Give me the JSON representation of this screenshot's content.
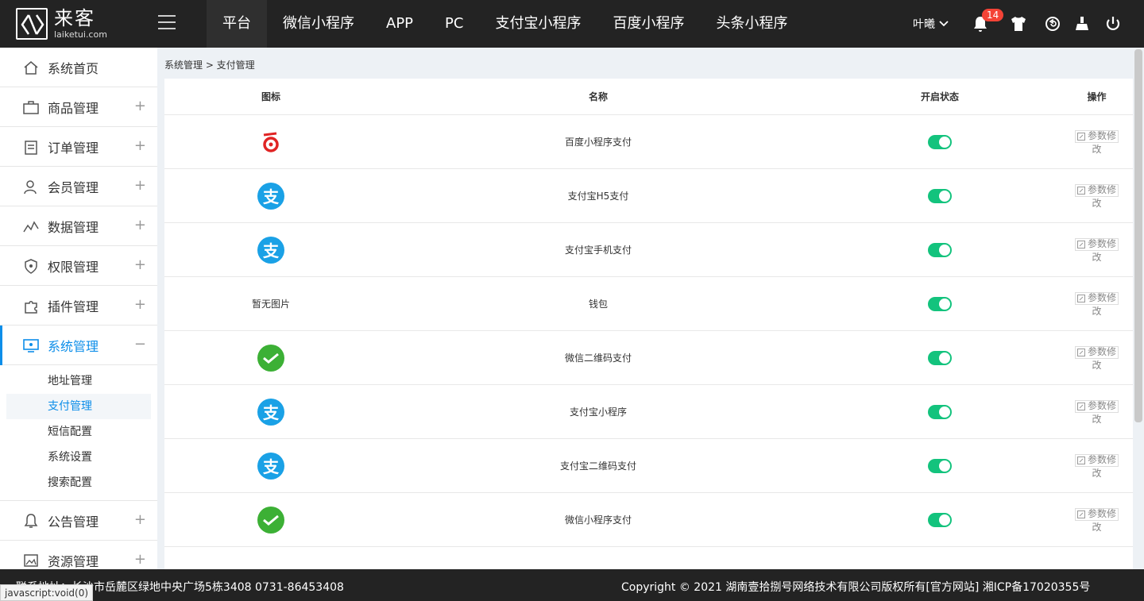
{
  "header": {
    "logo_cn": "来客",
    "logo_en": "laiketui.com",
    "nav": [
      "平台",
      "微信小程序",
      "APP",
      "PC",
      "支付宝小程序",
      "百度小程序",
      "头条小程序"
    ],
    "user": "叶曦",
    "notify_count": "14",
    "icons": [
      "bell-icon",
      "shirt-icon",
      "refresh-icon",
      "broom-icon",
      "power-icon"
    ]
  },
  "sidebar": {
    "items": [
      {
        "label": "系统首页",
        "icon": "home-icon",
        "expandable": false
      },
      {
        "label": "商品管理",
        "icon": "briefcase-icon",
        "expandable": true
      },
      {
        "label": "订单管理",
        "icon": "clipboard-icon",
        "expandable": true
      },
      {
        "label": "会员管理",
        "icon": "users-icon",
        "expandable": true
      },
      {
        "label": "数据管理",
        "icon": "chart-icon",
        "expandable": true
      },
      {
        "label": "权限管理",
        "icon": "shield-icon",
        "expandable": true
      },
      {
        "label": "插件管理",
        "icon": "puzzle-icon",
        "expandable": true
      },
      {
        "label": "系统管理",
        "icon": "monitor-icon",
        "expandable": true,
        "active": true
      },
      {
        "label": "公告管理",
        "icon": "bell-icon",
        "expandable": true
      },
      {
        "label": "资源管理",
        "icon": "image-icon",
        "expandable": true
      }
    ],
    "submenu": [
      "地址管理",
      "支付管理",
      "短信配置",
      "系统设置",
      "搜索配置"
    ],
    "collapse_symbol": "−",
    "expand_symbol": "+"
  },
  "breadcrumb": "系统管理 > 支付管理",
  "table": {
    "headers": [
      "图标",
      "名称",
      "开启状态",
      "操作"
    ],
    "rows": [
      {
        "icon": "baidu",
        "name": "百度小程序支付",
        "enabled": true
      },
      {
        "icon": "alipay",
        "name": "支付宝H5支付",
        "enabled": true
      },
      {
        "icon": "alipay",
        "name": "支付宝手机支付",
        "enabled": true
      },
      {
        "icon": "none",
        "no_image": "暂无图片",
        "name": "钱包",
        "enabled": true
      },
      {
        "icon": "wechat",
        "name": "微信二维码支付",
        "enabled": true
      },
      {
        "icon": "alipay",
        "name": "支付宝小程序",
        "enabled": true
      },
      {
        "icon": "alipay",
        "name": "支付宝二维码支付",
        "enabled": true
      },
      {
        "icon": "wechat",
        "name": "微信小程序支付",
        "enabled": true
      }
    ],
    "op_label_1": "参数修",
    "op_label_2": "改",
    "alipay_glyph": "支"
  },
  "footer": {
    "left": "联系地址：长沙市岳麓区绿地中央广场5栋3408 0731-86453408",
    "right": "Copyright © 2021 湖南壹拾捌号网络技术有限公司版权所有[官方网站]   湘ICP备17020355号"
  },
  "status_tip": "javascript:void(0)",
  "colors": {
    "accent": "#0d8ee9",
    "toggle_on": "#13c37d",
    "alipay": "#1aa1e6",
    "wechat": "#3cb035",
    "topbar": "#232323"
  }
}
